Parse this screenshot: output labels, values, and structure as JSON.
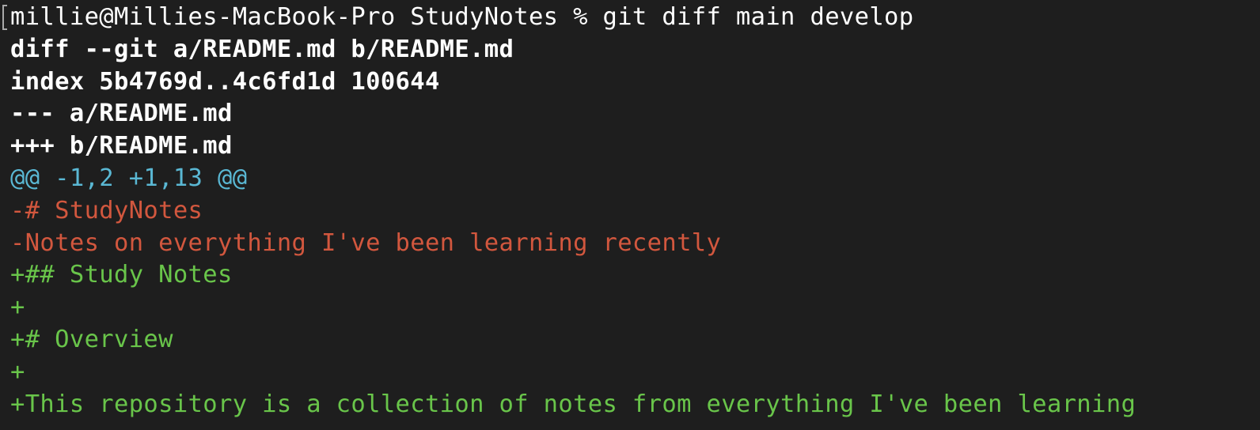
{
  "terminal": {
    "prompt_line": "millie@Millies-MacBook-Pro StudyNotes % git diff main develop",
    "diff_header": {
      "git_line": "diff --git a/README.md b/README.md",
      "index_line": "index 5b4769d..4c6fd1d 100644",
      "old_file_line": "--- a/README.md",
      "new_file_line": "+++ b/README.md"
    },
    "hunk_header": "@@ -1,2 +1,13 @@",
    "removed_lines": [
      "-# StudyNotes",
      "-Notes on everything I've been learning recently"
    ],
    "added_lines": [
      "+## Study Notes",
      "+",
      "+# Overview",
      "+",
      "+This repository is a collection of notes from everything I've been learning"
    ],
    "colors": {
      "background": "#1e1e1e",
      "header_text": "#ffffff",
      "hunk": "#5ab8d4",
      "removed": "#d2573e",
      "added": "#69c54a"
    }
  }
}
